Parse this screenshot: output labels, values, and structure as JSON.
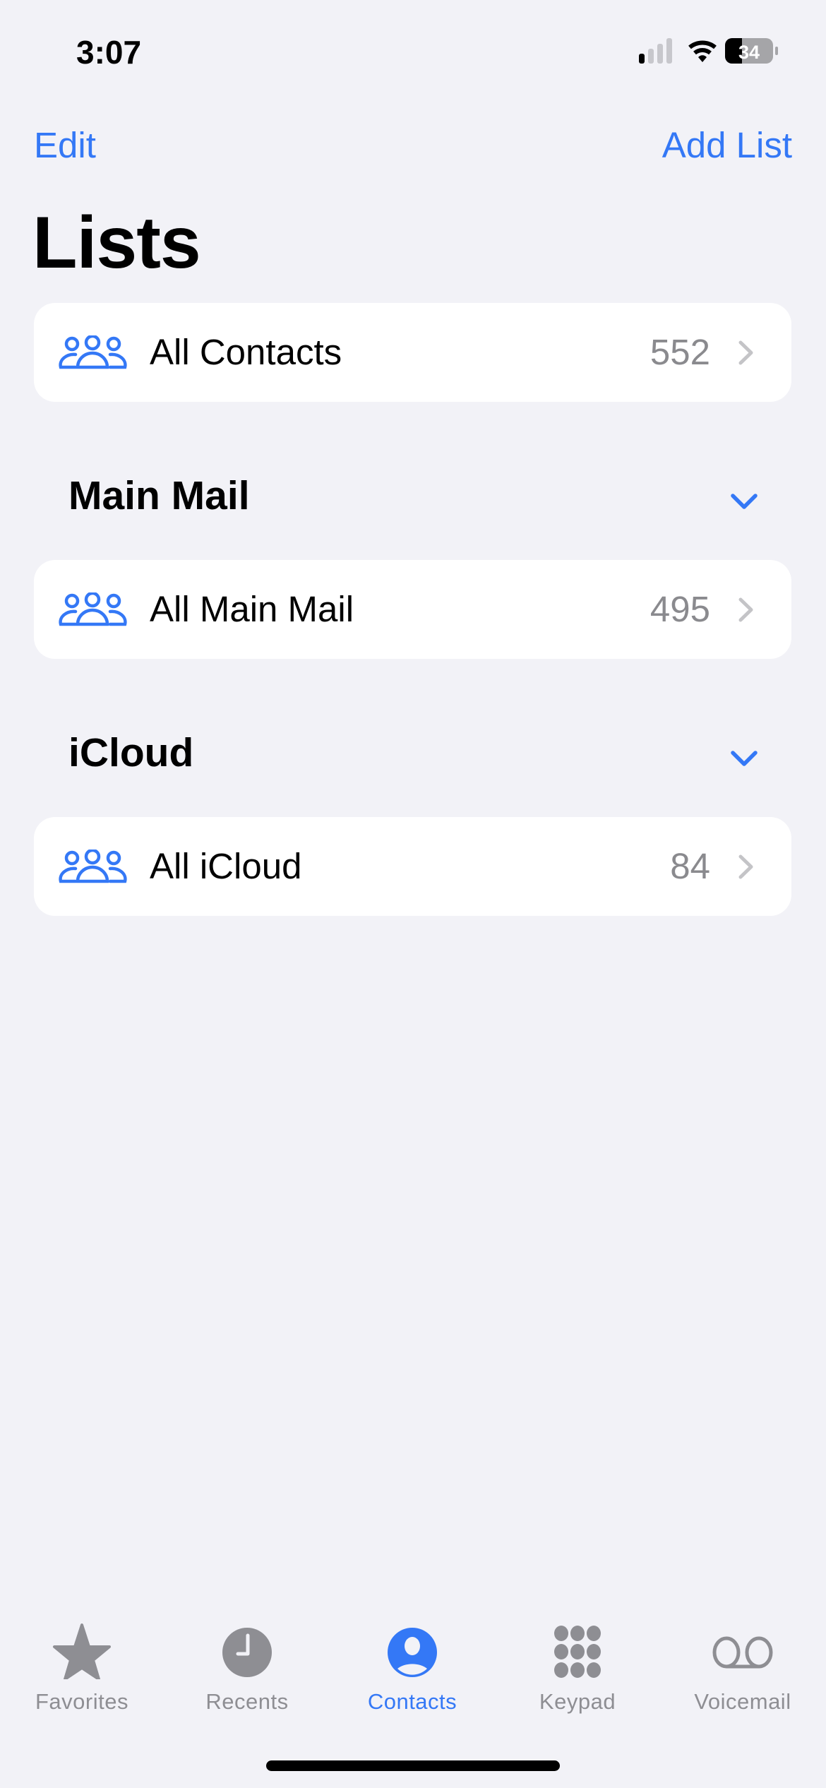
{
  "status_bar": {
    "time": "3:07",
    "signal_bars_active": 1,
    "signal_bars_total": 4,
    "wifi": "wifi-icon",
    "battery_percent": "34"
  },
  "nav": {
    "left_button": "Edit",
    "right_button": "Add List",
    "title": "Lists"
  },
  "top_list": {
    "label": "All Contacts",
    "count": "552",
    "icon": "group-icon"
  },
  "sections": [
    {
      "header": "Main Mail",
      "toggle_icon": "chevron-down-icon",
      "rows": [
        {
          "label": "All Main Mail",
          "count": "495",
          "icon": "group-icon"
        }
      ]
    },
    {
      "header": "iCloud",
      "toggle_icon": "chevron-down-icon",
      "rows": [
        {
          "label": "All iCloud",
          "count": "84",
          "icon": "group-icon"
        }
      ]
    }
  ],
  "tabbar": {
    "active": "Contacts",
    "tabs": [
      {
        "label": "Favorites",
        "icon": "star-icon"
      },
      {
        "label": "Recents",
        "icon": "clock-icon"
      },
      {
        "label": "Contacts",
        "icon": "person-circle-icon"
      },
      {
        "label": "Keypad",
        "icon": "keypad-icon"
      },
      {
        "label": "Voicemail",
        "icon": "voicemail-icon"
      }
    ]
  },
  "colors": {
    "accent": "#3478f6",
    "background": "#f2f2f7",
    "card": "#ffffff",
    "secondary_text": "#8a8a8e",
    "tab_inactive": "#8e8e93",
    "chevron": "#c4c4c7"
  }
}
